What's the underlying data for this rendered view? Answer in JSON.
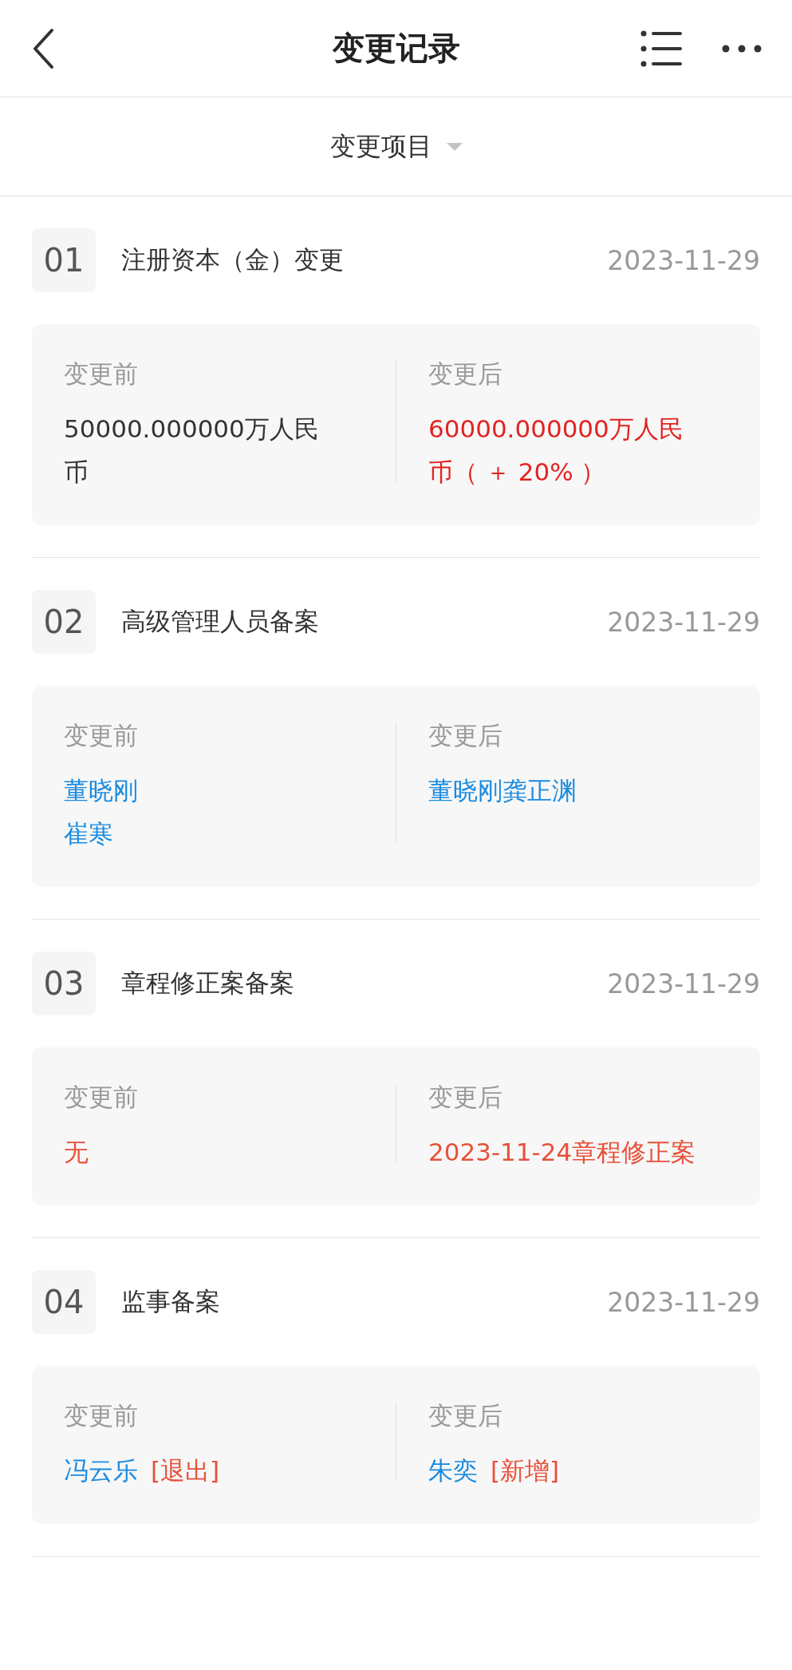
{
  "header": {
    "title": "变更记录"
  },
  "filter": {
    "label": "变更项目"
  },
  "records": [
    {
      "index": "01",
      "title": "注册资本（金）变更",
      "date": "2023-11-29",
      "before_label": "变更前",
      "after_label": "变更后",
      "before": [
        [
          {
            "text": "50000.000000万人民币",
            "kind": "plain"
          }
        ]
      ],
      "after": [
        [
          {
            "text": "60000.000000万人民币（ ＋ 20% ）",
            "kind": "increase"
          }
        ]
      ]
    },
    {
      "index": "02",
      "title": "高级管理人员备案",
      "date": "2023-11-29",
      "before_label": "变更前",
      "after_label": "变更后",
      "before": [
        [
          {
            "text": "董晓刚",
            "kind": "person"
          }
        ],
        [
          {
            "text": "崔寒",
            "kind": "person"
          }
        ]
      ],
      "after": [
        [
          {
            "text": "董晓刚龚正渊",
            "kind": "person"
          }
        ]
      ]
    },
    {
      "index": "03",
      "title": "章程修正案备案",
      "date": "2023-11-29",
      "before_label": "变更前",
      "after_label": "变更后",
      "before": [
        [
          {
            "text": "无",
            "kind": "changed"
          }
        ]
      ],
      "after": [
        [
          {
            "text": "2023-11-24章程修正案",
            "kind": "changed"
          }
        ]
      ]
    },
    {
      "index": "04",
      "title": "监事备案",
      "date": "2023-11-29",
      "before_label": "变更前",
      "after_label": "变更后",
      "before": [
        [
          {
            "text": "冯云乐",
            "kind": "person"
          },
          {
            "text": "[退出]",
            "kind": "tag"
          }
        ]
      ],
      "after": [
        [
          {
            "text": "朱奕",
            "kind": "person"
          },
          {
            "text": "[新增]",
            "kind": "tag"
          }
        ]
      ]
    }
  ]
}
